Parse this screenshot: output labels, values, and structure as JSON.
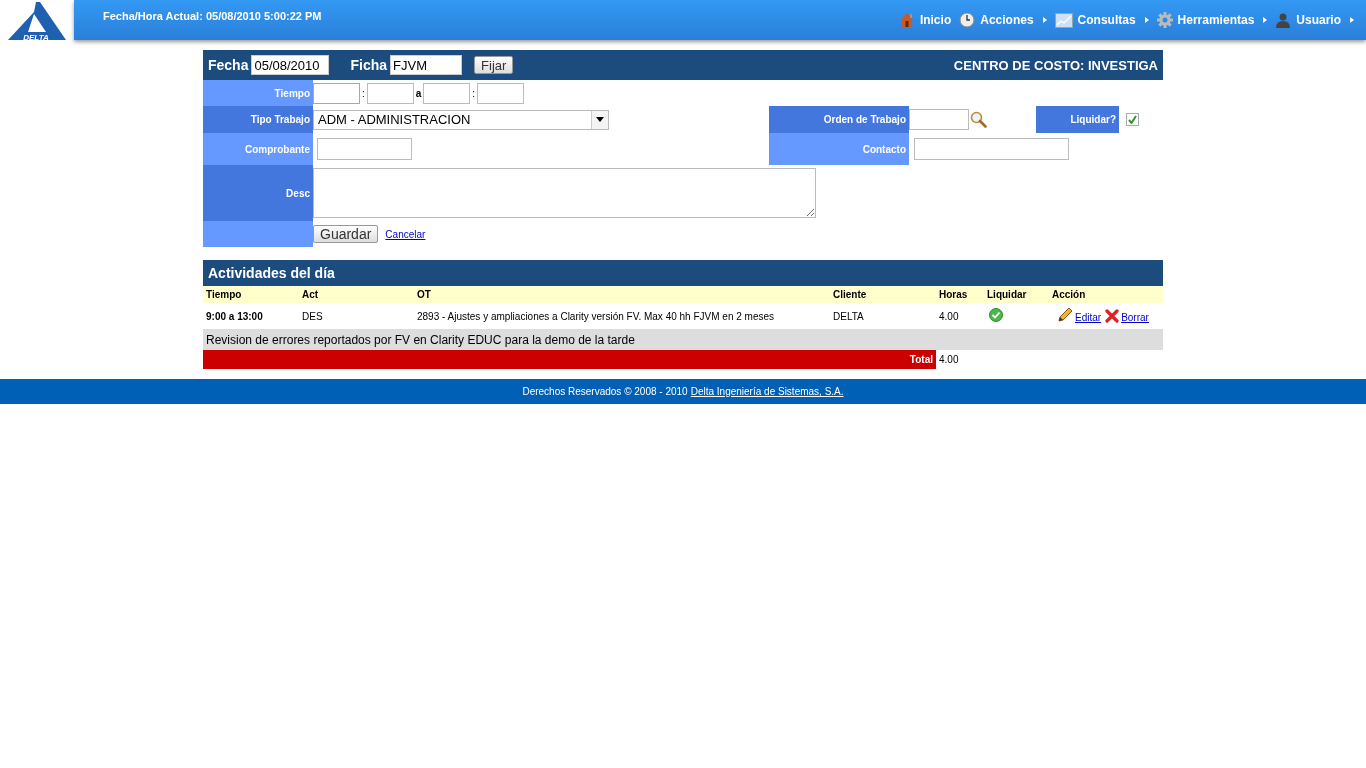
{
  "header": {
    "logo_text": "DELTA",
    "datetime": "Fecha/Hora Actual: 05/08/2010 5:00:22 PM",
    "menu": [
      {
        "kind": "home",
        "label": "Inicio",
        "has_submenu": false
      },
      {
        "kind": "clock",
        "label": "Acciones",
        "has_submenu": true
      },
      {
        "kind": "chart",
        "label": "Consultas",
        "has_submenu": true
      },
      {
        "kind": "gear",
        "label": "Herramientas",
        "has_submenu": true
      },
      {
        "kind": "user",
        "label": "Usuario",
        "has_submenu": true
      }
    ]
  },
  "form": {
    "fecha_label": "Fecha",
    "fecha_value": "05/08/2010",
    "ficha_label": "Ficha",
    "ficha_value": "FJVM",
    "fijar_button": "Fijar",
    "centro_costo": "CENTRO DE COSTO: INVESTIGA",
    "tiempo_label": "Tiempo",
    "tiempo_separator_1": ":",
    "tiempo_to": "a",
    "tiempo_separator_2": ":",
    "tipo_trabajo_label": "Tipo Trabajo",
    "tipo_trabajo_value": "ADM - ADMINISTRACION",
    "orden_trabajo_label": "Orden de Trabajo",
    "liquidar_label": "Liquidar?",
    "liquidar_checked": true,
    "comprobante_label": "Comprobante",
    "contacto_label": "Contacto",
    "desc_label": "Desc",
    "guardar_button": "Guardar",
    "cancelar_link": "Cancelar"
  },
  "activities": {
    "title": "Actividades del día",
    "columns": [
      "Tiempo",
      "Act",
      "OT",
      "Cliente",
      "Horas",
      "Liquidar",
      "Acción"
    ],
    "rows": [
      {
        "tiempo": "9:00 a 13:00",
        "act": "DES",
        "ot": "2893 - Ajustes y ampliaciones a Clarity versión FV. Max 40 hh FJVM en 2 meses",
        "cliente": "DELTA",
        "horas": "4.00",
        "liquidar": true,
        "actions": [
          {
            "kind": "edit",
            "label": "Editar"
          },
          {
            "kind": "delete",
            "label": "Borrar"
          }
        ],
        "description": "Revision de errores reportados por FV en Clarity EDUC para la demo de la tarde"
      }
    ],
    "total_label": "Total",
    "total_value": "4.00"
  },
  "footer": {
    "text": "Derechos Reservados © 2008 - 2010",
    "link": "Delta Ingeniería de Sistemas, S.A."
  }
}
